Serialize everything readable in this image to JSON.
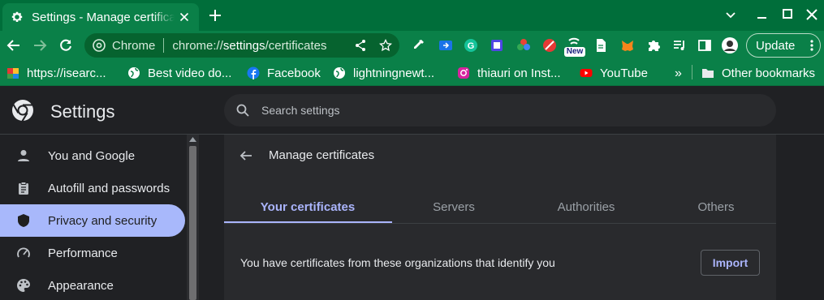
{
  "browser": {
    "tab_title": "Settings - Manage certificates",
    "omnibox": {
      "chip": "Chrome",
      "url_prefix": "chrome://",
      "url_host": "settings",
      "url_path": "/certificates"
    },
    "update_label": "Update",
    "new_badge": "New",
    "bookmarks": [
      {
        "label": "https://isearc...",
        "icon": "isearch-favicon"
      },
      {
        "label": "Best video do...",
        "icon": "globe-icon"
      },
      {
        "label": "Facebook",
        "icon": "facebook-icon"
      },
      {
        "label": "lightningnewt...",
        "icon": "globe-icon"
      },
      {
        "label": "thiauri on Inst...",
        "icon": "instagram-icon"
      },
      {
        "label": "YouTube",
        "icon": "youtube-icon"
      }
    ],
    "bookmarks_more": "»",
    "other_bookmarks": "Other bookmarks",
    "colors": {
      "frame": "#006e3a",
      "toolbar": "#0a8048",
      "omnibox": "#06632f"
    }
  },
  "settings": {
    "title": "Settings",
    "search_placeholder": "Search settings",
    "nav": [
      {
        "label": "You and Google",
        "icon": "person-icon",
        "active": false
      },
      {
        "label": "Autofill and passwords",
        "icon": "clipboard-icon",
        "active": false
      },
      {
        "label": "Privacy and security",
        "icon": "shield-icon",
        "active": true
      },
      {
        "label": "Performance",
        "icon": "speedometer-icon",
        "active": false
      },
      {
        "label": "Appearance",
        "icon": "palette-icon",
        "active": false
      }
    ],
    "page": {
      "title": "Manage certificates",
      "tabs": [
        "Your certificates",
        "Servers",
        "Authorities",
        "Others"
      ],
      "active_tab": "Your certificates",
      "description": "You have certificates from these organizations that identify you",
      "import_label": "Import"
    },
    "colors": {
      "accent": "#aab4fb",
      "background": "#202124",
      "card": "#292a2d"
    }
  }
}
